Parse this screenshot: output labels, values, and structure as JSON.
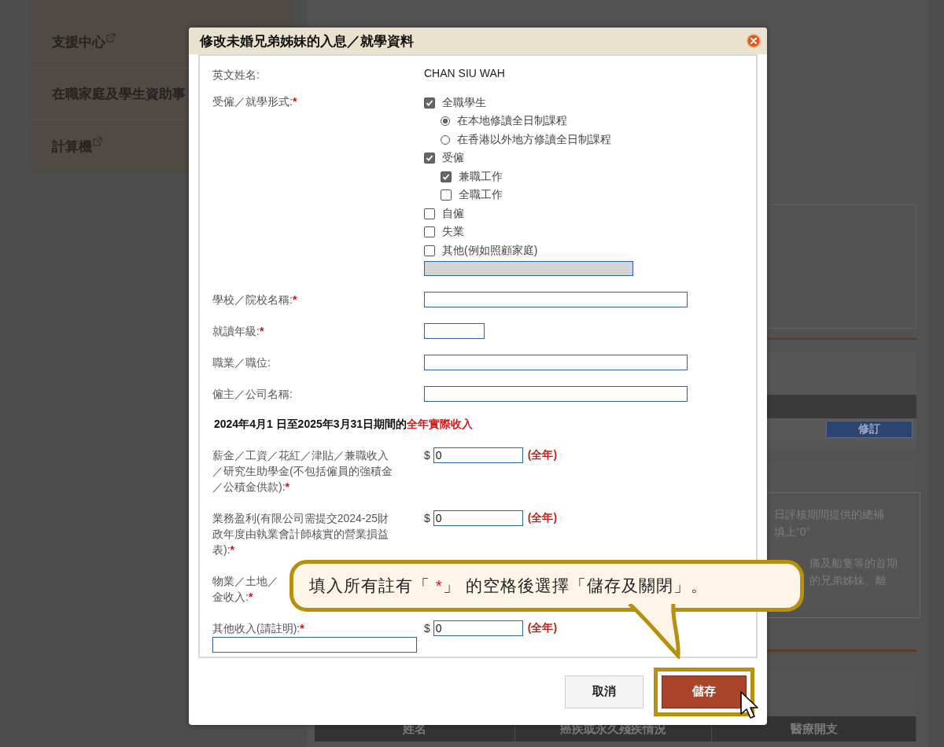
{
  "sidebar": {
    "items": [
      {
        "label": "支援中心",
        "external": true
      },
      {
        "label": "在職家庭及學生資助事",
        "external": false
      },
      {
        "label": "計算機",
        "external": true
      }
    ]
  },
  "background": {
    "edit_button": "修訂",
    "note_lines": [
      "日評核期間提供的總補",
      "填上“0”",
      "痛及船隻等的首期",
      "的兄弟姊妹、離"
    ],
    "table_columns": [
      "姓名",
      "癌疾或永久殘疾情況",
      "醫療開支"
    ]
  },
  "dialog": {
    "title": "修改未婚兄弟姊妹的入息／就學資料",
    "required_mark": "*",
    "name_label": "英文姓名:",
    "name_value": "CHAN SIU WAH",
    "status_label": "受僱／就學形式:",
    "status_required": true,
    "status_options": [
      {
        "kind": "checkbox",
        "label": "全職學生",
        "checked": true,
        "children": [
          {
            "kind": "radio",
            "label": "在本地修讀全日制課程",
            "selected": true
          },
          {
            "kind": "radio",
            "label": "在香港以外地方修讀全日制課程",
            "selected": false
          }
        ]
      },
      {
        "kind": "checkbox",
        "label": "受僱",
        "checked": true,
        "children": [
          {
            "kind": "checkbox",
            "label": "兼職工作",
            "checked": true
          },
          {
            "kind": "checkbox",
            "label": "全職工作",
            "checked": false
          }
        ]
      },
      {
        "kind": "checkbox",
        "label": "自僱",
        "checked": false
      },
      {
        "kind": "checkbox",
        "label": "失業",
        "checked": false
      },
      {
        "kind": "checkbox",
        "label": "其他(例如照顧家庭)",
        "checked": false
      }
    ],
    "other_field": {
      "disabled": true
    },
    "text_fields": [
      {
        "label": "學校／院校名稱:",
        "required": true,
        "kind": "wide"
      },
      {
        "label": "就讀年級:",
        "required": true,
        "kind": "short"
      },
      {
        "label": "職業／職位:",
        "required": false,
        "kind": "wide"
      },
      {
        "label": "僱主／公司名稱:",
        "required": false,
        "kind": "wide"
      }
    ],
    "income_heading": {
      "text": "2024年4月1 日至2025年3月31日期間的",
      "highlight": "全年實際收入"
    },
    "income_rows": [
      {
        "kind": "amount",
        "label_lines": [
          "薪金／工資／花紅／津貼／兼職收入",
          "／研究生助學金(不包括僱員的強積金",
          "／公積金供款):"
        ],
        "required": true,
        "currency": "$",
        "value": "0",
        "period": "(全年)"
      },
      {
        "kind": "amount",
        "label_lines": [
          "業務盈利(有限公司需提交2024-25財",
          "政年度由執業會計師核實的營業損益",
          "表):"
        ],
        "required": true,
        "currency": "$",
        "value": "0",
        "period": "(全年)"
      },
      {
        "kind": "covered",
        "label_lines": [
          "物業／土地／",
          "金收入:"
        ],
        "required": true
      },
      {
        "kind": "amount_with_note",
        "label_lines": [
          "其他收入(請註明):"
        ],
        "required": true,
        "currency": "$",
        "value": "0",
        "period": "(全年)"
      }
    ],
    "buttons": [
      {
        "label": "取消",
        "kind": "secondary",
        "highlighted": false
      },
      {
        "label": "儲存",
        "kind": "primary",
        "highlighted": true
      }
    ]
  },
  "callout": {
    "before": "填入所有註有「 ",
    "mark": "*",
    "after": "」 的空格後選擇「儲存及關閉」。"
  }
}
